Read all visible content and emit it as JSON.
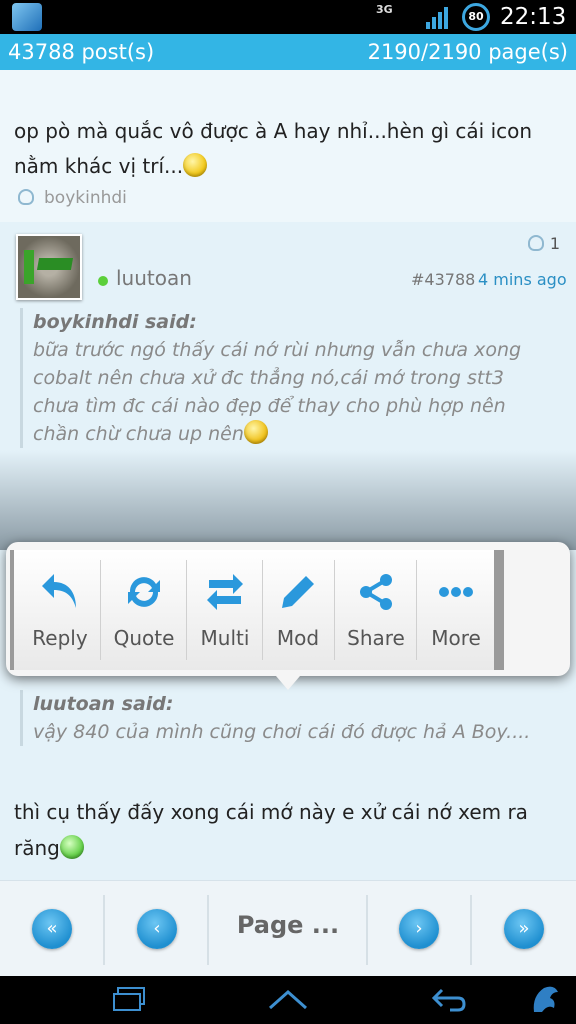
{
  "status_bar": {
    "network": "3G",
    "battery": "80",
    "time": "22:13"
  },
  "info_bar": {
    "posts": "43788 post(s)",
    "pages": "2190/2190 page(s)"
  },
  "post1": {
    "text": "op pò mà quắc vô được à A hay nhỉ...hèn gì cái icon nằm khác vị trí...",
    "author": "boykinhdi"
  },
  "post2": {
    "like_count": "1",
    "username": "luutoan",
    "post_number": "#43788",
    "time": "4 mins ago",
    "quote": {
      "author": "boykinhdi said:",
      "text": "bữa trước ngó thấy cái nớ rùi nhưng vẫn chưa xong cobalt nên chưa xử đc thẳng nó,cái mớ trong stt3 chưa tìm đc cái nào đẹp để thay cho phù hợp nên chần chừ chưa up nên"
    }
  },
  "post3": {
    "quote": {
      "author": "luutoan said:",
      "text": "vậy 840 của mình cũng chơi cái đó được hả A Boy...."
    },
    "text": "thì cụ thấy đấy xong cái mớ này e xử cái nớ xem ra răng"
  },
  "context_menu": {
    "items": [
      {
        "label": "Reply",
        "icon": "reply-icon"
      },
      {
        "label": "Quote",
        "icon": "quote-icon"
      },
      {
        "label": "Multi",
        "icon": "multi-icon"
      },
      {
        "label": "Mod",
        "icon": "pencil-icon"
      },
      {
        "label": "Share",
        "icon": "share-icon"
      },
      {
        "label": "More",
        "icon": "more-icon"
      }
    ]
  },
  "page_nav": {
    "page_label": "Page ..."
  },
  "colors": {
    "accent": "#33b5e5",
    "link": "#2a8fc4"
  }
}
